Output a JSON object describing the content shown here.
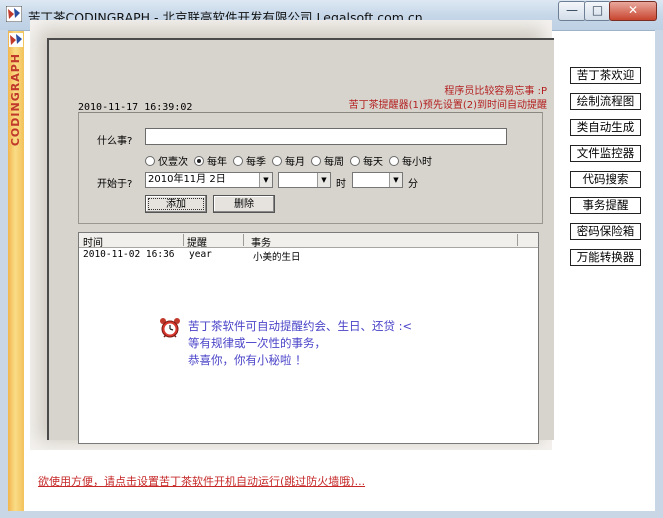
{
  "window": {
    "title": "苦丁茶CODINGRAPH - 北京联高软件开发有限公司 Legalsoft.com.cn",
    "minimize_glyph": "—",
    "maximize_glyph": "□",
    "close_glyph": "✕"
  },
  "brand": {
    "word": "CODINGRAPH"
  },
  "header": {
    "datetime": "2010-11-17 16:39:02",
    "memo_title": "程序员比较容易忘事 :P",
    "memo_sub": "苦丁茶提醒器(1)预先设置(2)到时间自动提醒"
  },
  "form": {
    "what_label": "什么事?",
    "what_value": "",
    "repeat_options": [
      "仅壹次",
      "每年",
      "每季",
      "每月",
      "每周",
      "每天",
      "每小时"
    ],
    "repeat_selected": "每年",
    "start_label": "开始于?",
    "date_value": "2010年11月 2日",
    "hour_value": "",
    "hour_unit": "时",
    "minute_value": "",
    "minute_unit": "分",
    "add_button": "添加",
    "delete_button": "删除"
  },
  "list": {
    "columns": [
      "时间",
      "提醒",
      "事务"
    ],
    "rows": [
      {
        "time": "2010-11-02 16:36",
        "remind": "year",
        "task": "小美的生日"
      }
    ]
  },
  "promo": {
    "line1": "苦丁茶软件可自动提醒约会、生日、还贷 :<",
    "line2": "等有规律或一次性的事务，",
    "line3": "恭喜你，你有小秘啦 ！"
  },
  "sidebar": {
    "buttons": [
      "苦丁茶欢迎",
      "绘制流程图",
      "类自动生成",
      "文件监控器",
      "代码搜索",
      "事务提醒",
      "密码保险箱",
      "万能转换器"
    ]
  },
  "footer": {
    "link": "欲使用方便，请点击设置苦丁茶软件开机自动运行(跳过防火墙哦)..."
  },
  "colors": {
    "accent_red": "#c62828",
    "promo_blue": "#4a44c8",
    "brand_orange": "#f4b54d"
  }
}
